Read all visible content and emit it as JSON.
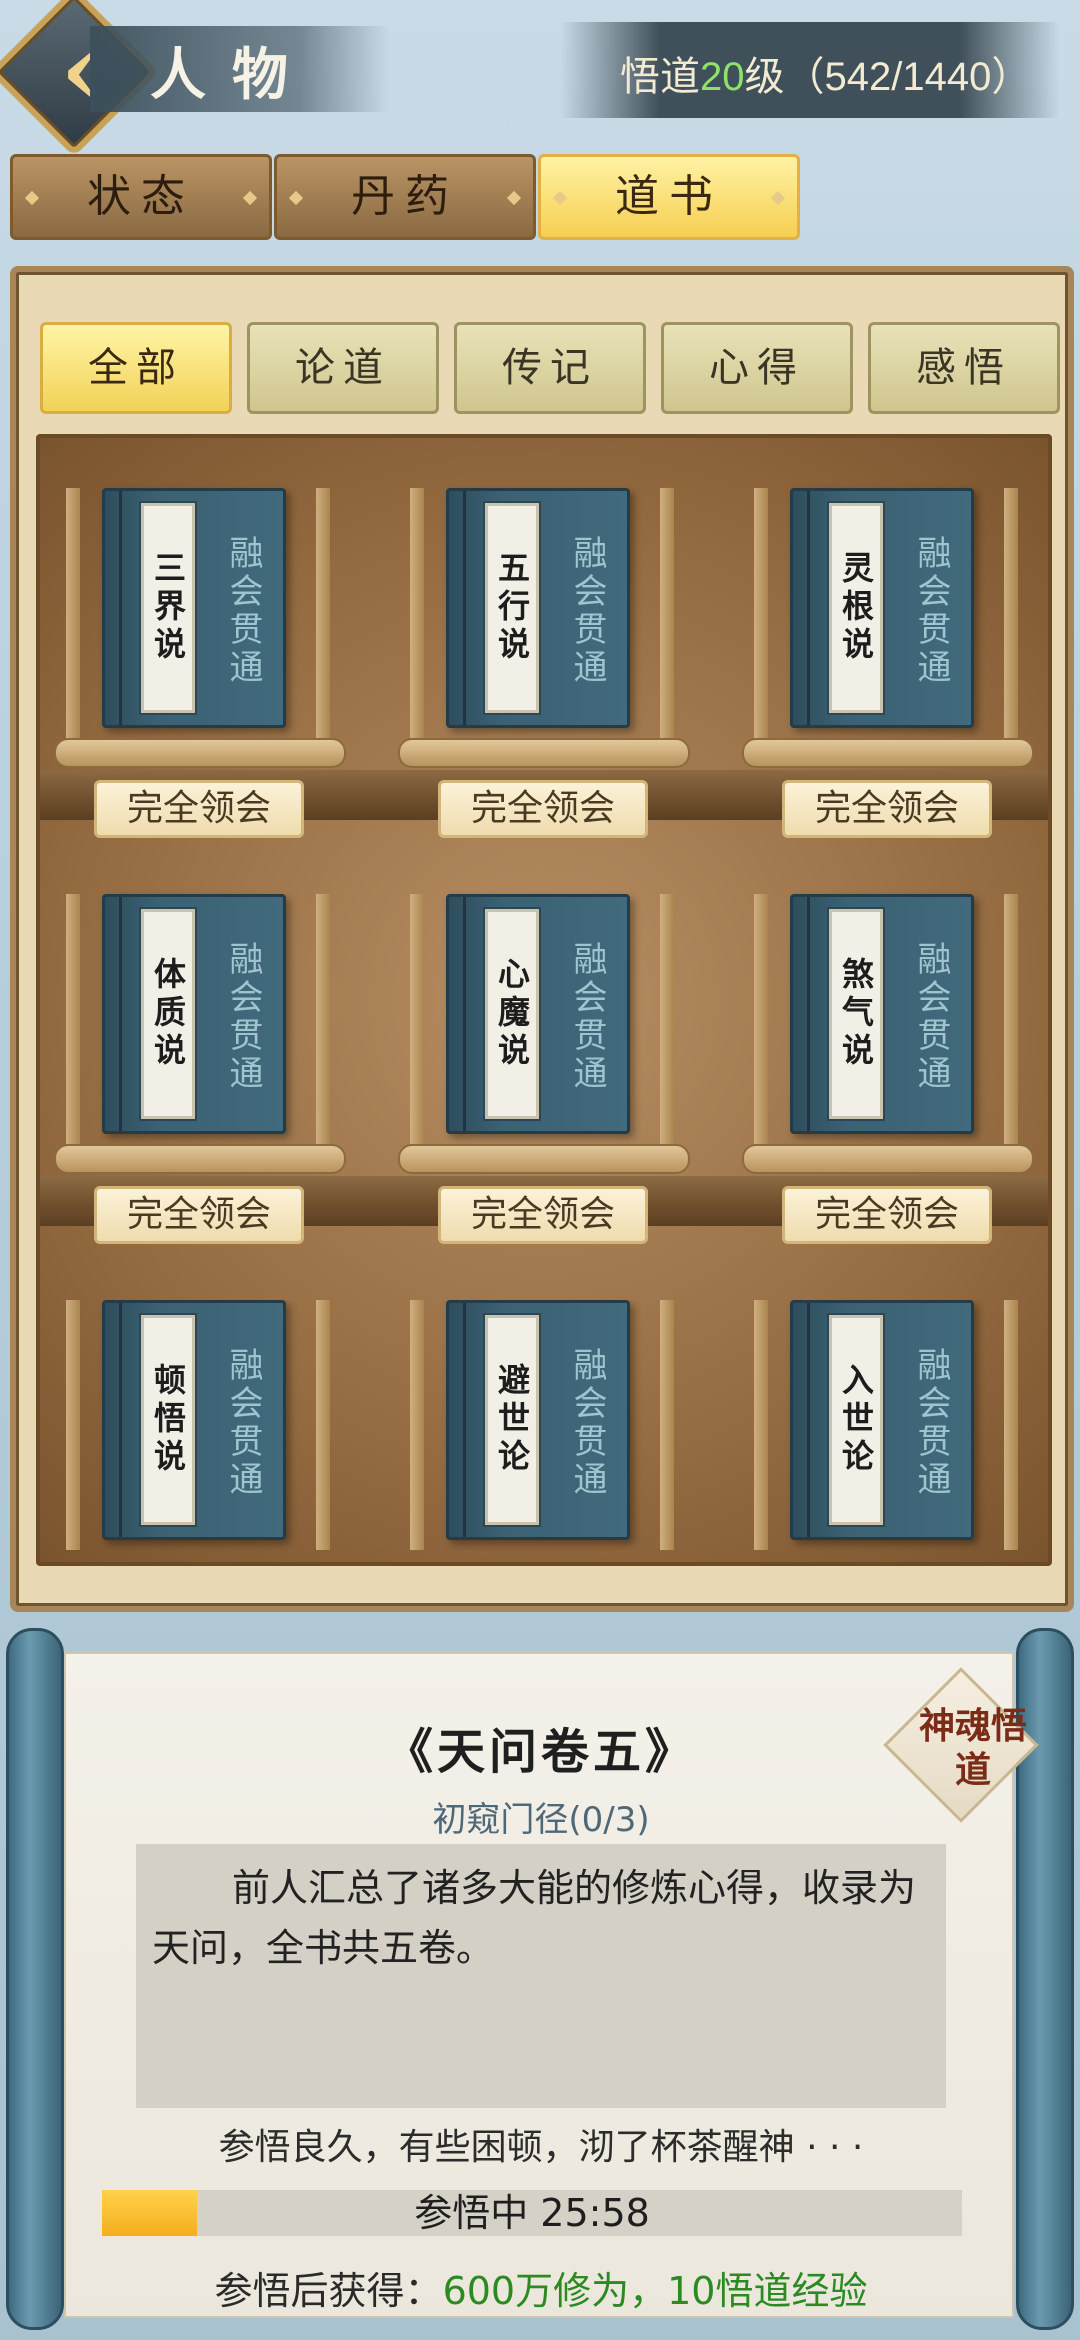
{
  "header": {
    "back_icon": "chevron-left-icon",
    "title": "人物",
    "level_prefix": "悟道",
    "level_value": "20",
    "level_suffix": "级（542/1440）"
  },
  "top_tabs": [
    {
      "label": "状态",
      "active": false
    },
    {
      "label": "丹药",
      "active": false
    },
    {
      "label": "道书",
      "active": true
    }
  ],
  "category_tabs": [
    {
      "label": "全部",
      "active": true
    },
    {
      "label": "论道",
      "active": false
    },
    {
      "label": "传记",
      "active": false
    },
    {
      "label": "心得",
      "active": false
    },
    {
      "label": "感悟",
      "active": false
    }
  ],
  "books": [
    {
      "title": "三界说",
      "status": "融会贯通",
      "tag": "完全领会"
    },
    {
      "title": "五行说",
      "status": "融会贯通",
      "tag": "完全领会"
    },
    {
      "title": "灵根说",
      "status": "融会贯通",
      "tag": "完全领会"
    },
    {
      "title": "体质说",
      "status": "融会贯通",
      "tag": "完全领会"
    },
    {
      "title": "心魔说",
      "status": "融会贯通",
      "tag": "完全领会"
    },
    {
      "title": "煞气说",
      "status": "融会贯通",
      "tag": "完全领会"
    },
    {
      "title": "顿悟说",
      "status": "融会贯通",
      "tag": ""
    },
    {
      "title": "避世论",
      "status": "融会贯通",
      "tag": ""
    },
    {
      "title": "入世论",
      "status": "融会贯通",
      "tag": ""
    }
  ],
  "detail": {
    "book_title": "《天问卷五》",
    "stage": "初窥门径(0/3)",
    "description": "前人汇总了诸多大能的修炼心得，收录为天问，全书共五卷。",
    "status_text": "参悟良久，有些困顿，沏了杯茶醒神 · · ·",
    "timer_text": "参悟中 25:58",
    "timer_progress": 0.11,
    "reward_label": "参悟后获得：",
    "reward_value": "600万修为，10悟道经验",
    "stamp_text": "神魂悟道"
  },
  "colors": {
    "accent_gold": "#f6cf52",
    "book_blue": "#3b6173",
    "reward_green": "#2b8a22",
    "level_green": "#8de26a"
  }
}
